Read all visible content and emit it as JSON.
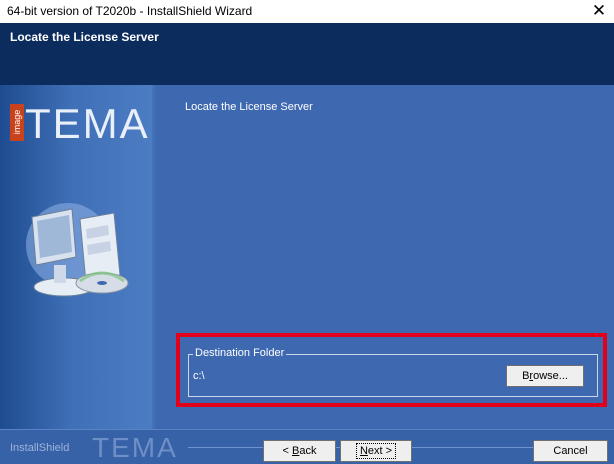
{
  "window": {
    "title": "64-bit version of T2020b - InstallShield Wizard",
    "close_glyph": "✕"
  },
  "header": {
    "title": "Locate the License Server"
  },
  "sidebar": {
    "logo_small": "image",
    "logo_text": "TEMA"
  },
  "main": {
    "heading": "Locate the License Server",
    "destination": {
      "legend": "Destination Folder",
      "path": "c:\\",
      "browse_label": "Browse...",
      "browse_mnemonic": "r"
    }
  },
  "footer": {
    "brand": "InstallShield",
    "logo_text": "TEMA",
    "back_label": "< Back",
    "next_label": "Next >",
    "cancel_label": "Cancel"
  },
  "colors": {
    "header": "#0d2c5e",
    "content": "#3e68b0",
    "highlight": "#e3001b",
    "badge": "#c8431b"
  }
}
